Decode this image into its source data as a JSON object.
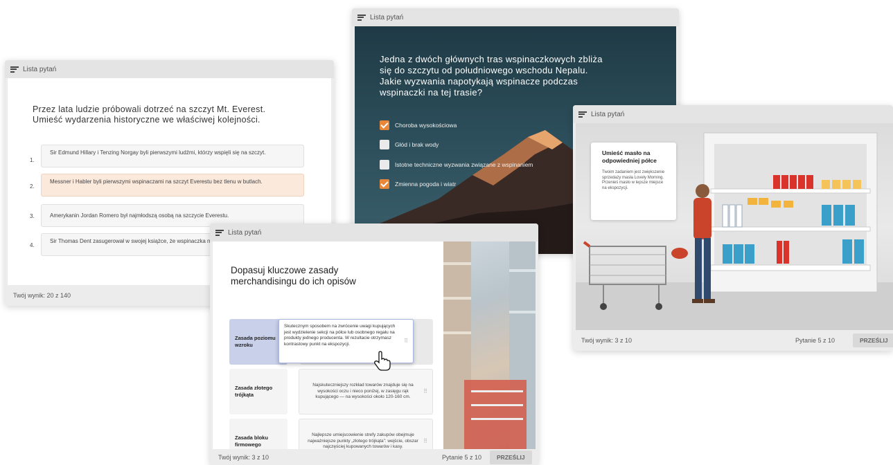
{
  "common": {
    "list_title": "Lista pytań"
  },
  "ordering": {
    "question": "Przez lata ludzie próbowali dotrzeć na szczyt Mt. Everest. Umieść wydarzenia historyczne we właściwej kolejności.",
    "items": [
      {
        "num": "1.",
        "text": "Sir Edmund Hillary i Tenzing Norgay byli pierwszymi ludźmi, którzy wspięli się na szczyt."
      },
      {
        "num": "2.",
        "text": "Messner i Habler byli pierwszymi wspinaczami na szczyt Everestu bez tlenu w butlach."
      },
      {
        "num": "3.",
        "text": "Amerykanin Jordan Romero był najmłodszą osobą na szczycie Everestu."
      },
      {
        "num": "4.",
        "text": "Sir Thomas Dent zasugerował w swojej książce, że wspinaczka na Mount Everest jest możliwa."
      }
    ],
    "score": "Twój wynik: 20 z 140"
  },
  "everest_quiz": {
    "question": "Jedna z dwóch głównych tras wspinaczkowych zbliża się do szczytu od południowego wschodu Nepalu. Jakie wyzwania napotykają wspinacze podczas wspinaczki na tej trasie?",
    "options": [
      {
        "label": "Choroba wysokościowa",
        "checked": true
      },
      {
        "label": "Głód i brak wody",
        "checked": false
      },
      {
        "label": "Istotne techniczne wyzwania związane z wspinaniem",
        "checked": false
      },
      {
        "label": "Zmienna pogoda i wiatr",
        "checked": true
      }
    ],
    "accent_color": "#e8873a"
  },
  "shelf": {
    "card_title": "Umieść masło na odpowiedniej półce",
    "card_text": "Twoim zadaniem jest zwiększenie sprzedaży masła Lovely Morning. Przenieś masło w lepsze miejsce na ekspozycji.",
    "score": "Twój wynik: 3 z 10",
    "progress": "Pytanie 5 z 10",
    "submit": "PRZEŚLIJ"
  },
  "matching": {
    "question": "Dopasuj kluczowe zasady merchandisingu do ich opisów",
    "terms": [
      {
        "label": "Zasada poziomu wzroku"
      },
      {
        "label": "Zasada złotego trójkąta"
      },
      {
        "label": "Zasada bloku firmowego"
      }
    ],
    "definitions": [
      {
        "text": "Najskuteczniejszy rozkład towarów znajduje się na wysokości oczu i nieco poniżej, w zasięgu rąk kupującego — na wysokości około 120-160 cm."
      },
      {
        "text": "Najlepsze umiejscowienie strefy zakupów obejmuje najważniejsze punkty „złotego trójkąta”: wejście, obszar najczęściej kupowanych towarów i kasy."
      }
    ],
    "dragged": "Skutecznym sposobem na zwrócenie uwagi kupujących jest wydzielenie sekcji na półce lub osobnego regału na produkty jednego producenta. W rezultacie otrzymasz kontrastowy punkt na ekspozycji.",
    "score": "Twój wynik: 3 z 10",
    "progress": "Pytanie 5 z 10",
    "submit": "PRZEŚLIJ",
    "term_active_color": "#c8d0ea"
  }
}
